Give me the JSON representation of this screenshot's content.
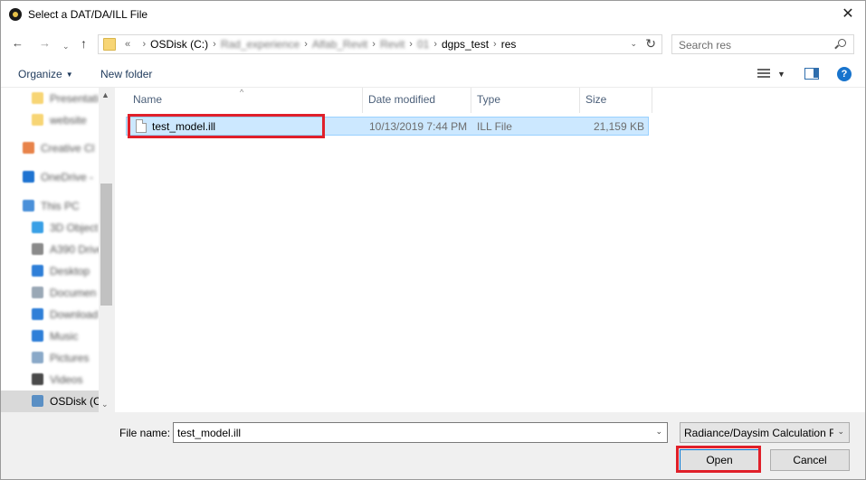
{
  "window": {
    "title": "Select a DAT/DA/ILL File",
    "close_glyph": "✕"
  },
  "nav": {
    "back": "←",
    "forward": "→",
    "recent_dd": "⌄",
    "up": "↑"
  },
  "address": {
    "overflow": "«",
    "crumbs": [
      {
        "label": "OSDisk (C:)",
        "blurred": false
      },
      {
        "label": "Rad_experience",
        "blurred": true
      },
      {
        "label": "Alfab_Revit",
        "blurred": true
      },
      {
        "label": "Revit",
        "blurred": true
      },
      {
        "label": "01",
        "blurred": true
      },
      {
        "label": "dgps_test",
        "blurred": false
      },
      {
        "label": "res",
        "blurred": false
      }
    ],
    "separator": "›",
    "dropdown": "⌄",
    "refresh": "↻"
  },
  "search": {
    "placeholder": "Search res"
  },
  "toolbar": {
    "organize": "Organize",
    "organize_caret": "▼",
    "new_folder": "New folder",
    "view_dd": "▼",
    "help": "?"
  },
  "sidebar": {
    "items": [
      {
        "label": "Presentati",
        "icon": "folder-icon",
        "color": "#f7d575"
      },
      {
        "label": "website",
        "icon": "folder-icon",
        "color": "#f7d575"
      },
      {
        "label": "Creative Cl",
        "icon": "creative-cloud-icon",
        "color": "#e8834a"
      },
      {
        "label": "OneDrive -",
        "icon": "cloud-icon",
        "color": "#1e73d1"
      },
      {
        "label": "This PC",
        "icon": "computer-icon",
        "color": "#4a90d9"
      },
      {
        "label": "3D Object",
        "icon": "3d-objects-icon",
        "color": "#39a0e6"
      },
      {
        "label": "A390 Drive",
        "icon": "drive-icon",
        "color": "#8a8a8a"
      },
      {
        "label": "Desktop",
        "icon": "desktop-icon",
        "color": "#2f7fd8"
      },
      {
        "label": "Documen",
        "icon": "documents-icon",
        "color": "#9aa8b6"
      },
      {
        "label": "Download",
        "icon": "downloads-icon",
        "color": "#2f7fd8"
      },
      {
        "label": "Music",
        "icon": "music-icon",
        "color": "#2f7fd8"
      },
      {
        "label": "Pictures",
        "icon": "pictures-icon",
        "color": "#8aa9c8"
      },
      {
        "label": "Videos",
        "icon": "videos-icon",
        "color": "#4a4a4a"
      },
      {
        "label": "OSDisk (C",
        "icon": "disk-icon",
        "color": "#5a8fc4"
      }
    ],
    "scroll_up": "▲",
    "scroll_down": "⌄"
  },
  "filelist": {
    "sort_indicator": "^",
    "columns": [
      "Name",
      "Date modified",
      "Type",
      "Size"
    ],
    "rows": [
      {
        "name": "test_model.ill",
        "date": "10/13/2019 7:44 PM",
        "type": "ILL File",
        "size": "21,159 KB"
      }
    ]
  },
  "footer": {
    "filename_label": "File name:",
    "filename_value": "test_model.ill",
    "filename_dd": "⌄",
    "filetype_value": "Radiance/Daysim Calculation F",
    "filetype_dd": "⌄",
    "open_label": "Open",
    "cancel_label": "Cancel"
  },
  "highlight_color": "#e0202a"
}
